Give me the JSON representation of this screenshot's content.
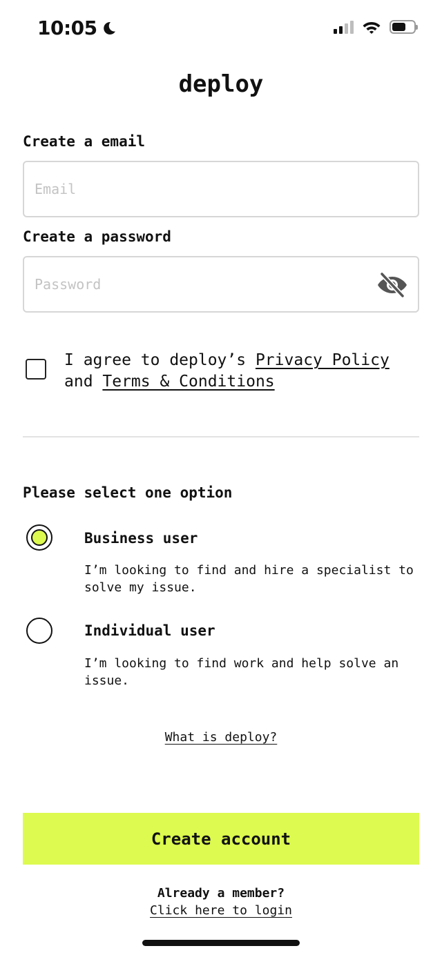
{
  "status_bar": {
    "time": "10:05",
    "icons": [
      "moon-icon",
      "signal-icon",
      "wifi-icon",
      "battery-icon"
    ]
  },
  "app": {
    "title": "deploy"
  },
  "form": {
    "email_label": "Create a email",
    "email_placeholder": "Email",
    "email_value": "",
    "password_label": "Create a password",
    "password_placeholder": "Password",
    "password_value": "",
    "password_toggle_icon": "eye-slash-icon"
  },
  "agreement": {
    "checked": false,
    "prefix": "I agree to deploy’s ",
    "privacy_link": "Privacy Policy",
    "middle": " and ",
    "terms_link": "Terms & Conditions"
  },
  "options": {
    "heading": "Please select one option",
    "selected": "business",
    "business": {
      "title": "Business user",
      "description": "I’m looking to find and hire a specialist to solve my issue."
    },
    "individual": {
      "title": "Individual user",
      "description": "I’m looking to find work and help solve an issue."
    }
  },
  "links": {
    "what_is": "What is deploy?"
  },
  "cta": {
    "label": "Create account"
  },
  "footer": {
    "member_question": "Already a member?",
    "login_link": "Click here to login"
  },
  "colors": {
    "accent": "#dcfa4f",
    "text": "#111111",
    "border": "#d6d6d6"
  }
}
